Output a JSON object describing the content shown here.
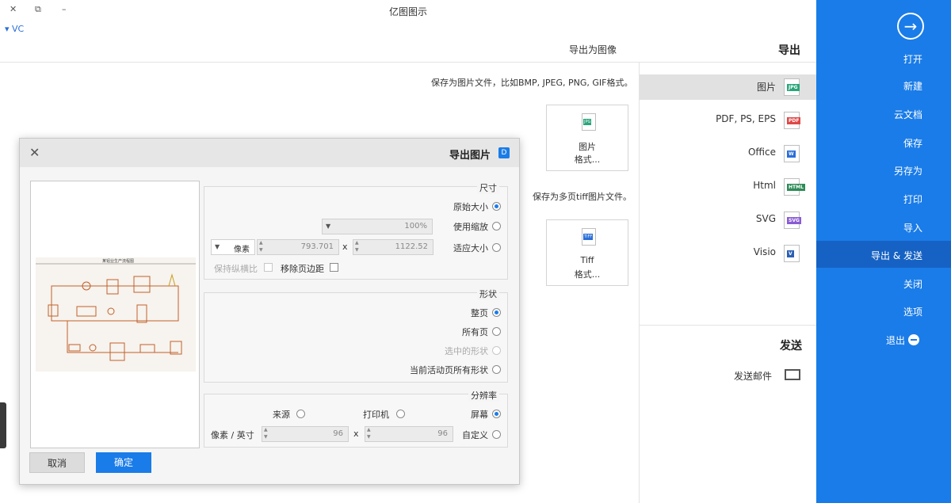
{
  "window": {
    "title": "亿图图示",
    "account": "VC",
    "min": "–",
    "restore": "⧉",
    "close": "✕"
  },
  "nav": {
    "back_icon": "arrow-right-circle-icon",
    "items": [
      "打开",
      "新建",
      "云文档",
      "保存",
      "另存为",
      "打印",
      "导入",
      "导出 & 发送",
      "关闭",
      "选项",
      "退出"
    ],
    "active": "导出 & 发送",
    "accent": "#1a7ce8"
  },
  "export_panel": {
    "title": "导出",
    "formats": [
      {
        "label": "图片",
        "icon": "JPG",
        "color": "#2aa57a"
      },
      {
        "label": "PDF, PS, EPS",
        "icon": "PDF",
        "color": "#e04848"
      },
      {
        "label": "Office",
        "icon": "W",
        "color": "#2b6fd8"
      },
      {
        "label": "Html",
        "icon": "HTML",
        "color": "#2e8b57"
      },
      {
        "label": "SVG",
        "icon": "SVG",
        "color": "#8a5bd6"
      },
      {
        "label": "Visio",
        "icon": "V",
        "color": "#2b5fb4"
      }
    ],
    "send_title": "发送",
    "send_item": "发送邮件"
  },
  "content": {
    "title": "导出为图像",
    "desc1": "保存为图片文件，比如BMP, JPEG, PNG, GIF格式。",
    "card1": {
      "icon": "JPG",
      "line1": "图片",
      "line2": "格式..."
    },
    "desc2": "保存为多页tiff图片文件。",
    "card2": {
      "icon": "TIFF",
      "line1": "Tiff",
      "line2": "格式..."
    }
  },
  "dialog": {
    "title": "导出图片",
    "size": {
      "label": "尺寸",
      "original": "原始大小",
      "scale": "使用缩放",
      "scale_value": "100%",
      "fit": "适应大小",
      "width": "1122.52",
      "x": "x",
      "height": "793.701",
      "unit": "像素",
      "remove_margin": "移除页边距",
      "keep_ratio": "保持纵横比"
    },
    "shape": {
      "label": "形状",
      "whole_page": "整页",
      "all_pages": "所有页",
      "selected": "选中的形状",
      "all_on_page": "当前活动页所有形状"
    },
    "resolution": {
      "label": "分辨率",
      "screen": "屏幕",
      "printer": "打印机",
      "source": "来源",
      "custom": "自定义",
      "dpi_x": "96",
      "x": "x",
      "dpi_y": "96",
      "unit": "像素 / 英寸"
    },
    "ok": "确定",
    "cancel": "取消",
    "preview_title": "某铝业生产流程图"
  }
}
